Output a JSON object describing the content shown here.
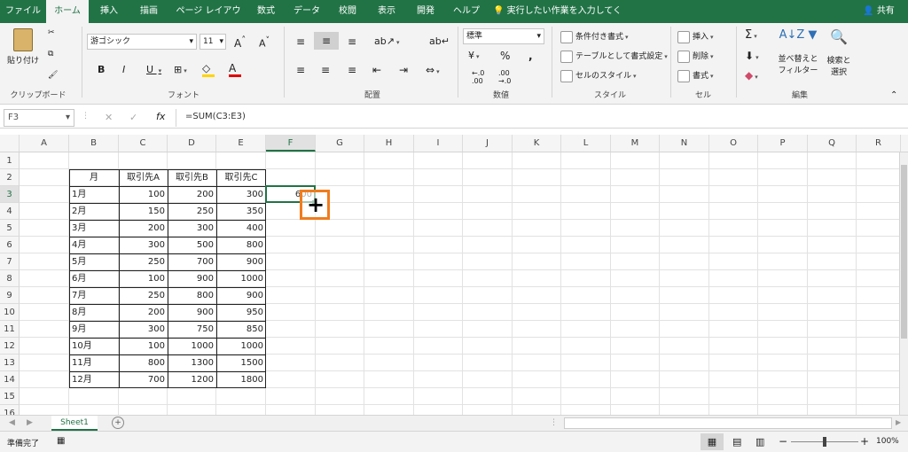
{
  "tabs": [
    "ファイル",
    "ホーム",
    "挿入",
    "描画",
    "ページ レイアウト",
    "数式",
    "データ",
    "校閲",
    "表示",
    "開発",
    "ヘルプ"
  ],
  "tellme": "実行したい作業を入力してください",
  "share": "共有",
  "ribbon": {
    "paste": "貼り付け",
    "clipboard": "クリップボード",
    "font_name": "游ゴシック",
    "font_size": "11",
    "font": "フォント",
    "align": "配置",
    "num_format": "標準",
    "number": "数値",
    "cond": "条件付き書式",
    "table": "テーブルとして書式設定",
    "cellstyle": "セルのスタイル",
    "styles": "スタイル",
    "insert": "挿入",
    "delete": "削除",
    "format": "書式",
    "cells": "セル",
    "sort": "並べ替えと",
    "sort2": "フィルター",
    "find": "検索と",
    "find2": "選択",
    "edit": "編集"
  },
  "namebox": "F3",
  "formula": "=SUM(C3:E3)",
  "columns": [
    "A",
    "B",
    "C",
    "D",
    "E",
    "F",
    "G",
    "H",
    "I",
    "J",
    "K",
    "L",
    "M",
    "N",
    "O",
    "P",
    "Q",
    "R"
  ],
  "rows": [
    "1",
    "2",
    "3",
    "4",
    "5",
    "6",
    "7",
    "8",
    "9",
    "10",
    "11",
    "12",
    "13",
    "14",
    "15",
    "16"
  ],
  "table": {
    "headers": [
      "月",
      "取引先A",
      "取引先B",
      "取引先C"
    ],
    "rows": [
      [
        "1月",
        "100",
        "200",
        "300"
      ],
      [
        "2月",
        "150",
        "250",
        "350"
      ],
      [
        "3月",
        "200",
        "300",
        "400"
      ],
      [
        "4月",
        "300",
        "500",
        "800"
      ],
      [
        "5月",
        "250",
        "700",
        "900"
      ],
      [
        "6月",
        "100",
        "900",
        "1000"
      ],
      [
        "7月",
        "250",
        "800",
        "900"
      ],
      [
        "8月",
        "200",
        "900",
        "950"
      ],
      [
        "9月",
        "300",
        "750",
        "850"
      ],
      [
        "10月",
        "100",
        "1000",
        "1000"
      ],
      [
        "11月",
        "800",
        "1300",
        "1500"
      ],
      [
        "12月",
        "700",
        "1200",
        "1800"
      ]
    ]
  },
  "f3_value": "600",
  "sheet": "Sheet1",
  "status": "準備完了",
  "zoom": "100%",
  "accent": "#217346",
  "highlight": "#f07c1e"
}
